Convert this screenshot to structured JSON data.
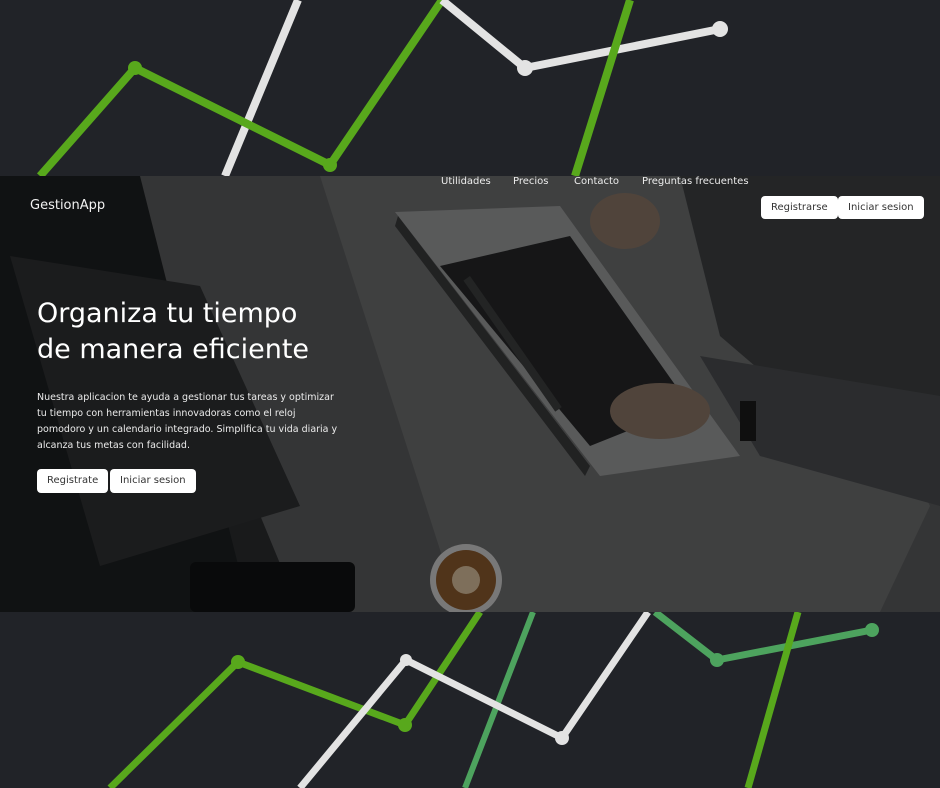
{
  "brand": "GestionApp",
  "nav": {
    "links": [
      "Utilidades",
      "Precios",
      "Contacto",
      "Preguntas frecuentes"
    ],
    "register_label": "Registrarse",
    "login_label": "Iniciar sesion"
  },
  "hero": {
    "title_line1": "Organiza tu tiempo",
    "title_line2": "de manera eficiente",
    "description": "Nuestra aplicacion te ayuda a gestionar tus tareas y optimizar tu tiempo con herramientas innovadoras como el reloj pomodoro y un calendario integrado. Simplifica tu vida diaria y alcanza tus metas con facilidad.",
    "register_label": "Registrate",
    "login_label": "Iniciar sesion"
  },
  "colors": {
    "background": "#212328",
    "accent_green": "#58a81c",
    "light_gray_line": "#e0e0e0",
    "button_bg": "#ffffff"
  },
  "icons": {
    "background_photo": "laptop-desk-photo"
  }
}
